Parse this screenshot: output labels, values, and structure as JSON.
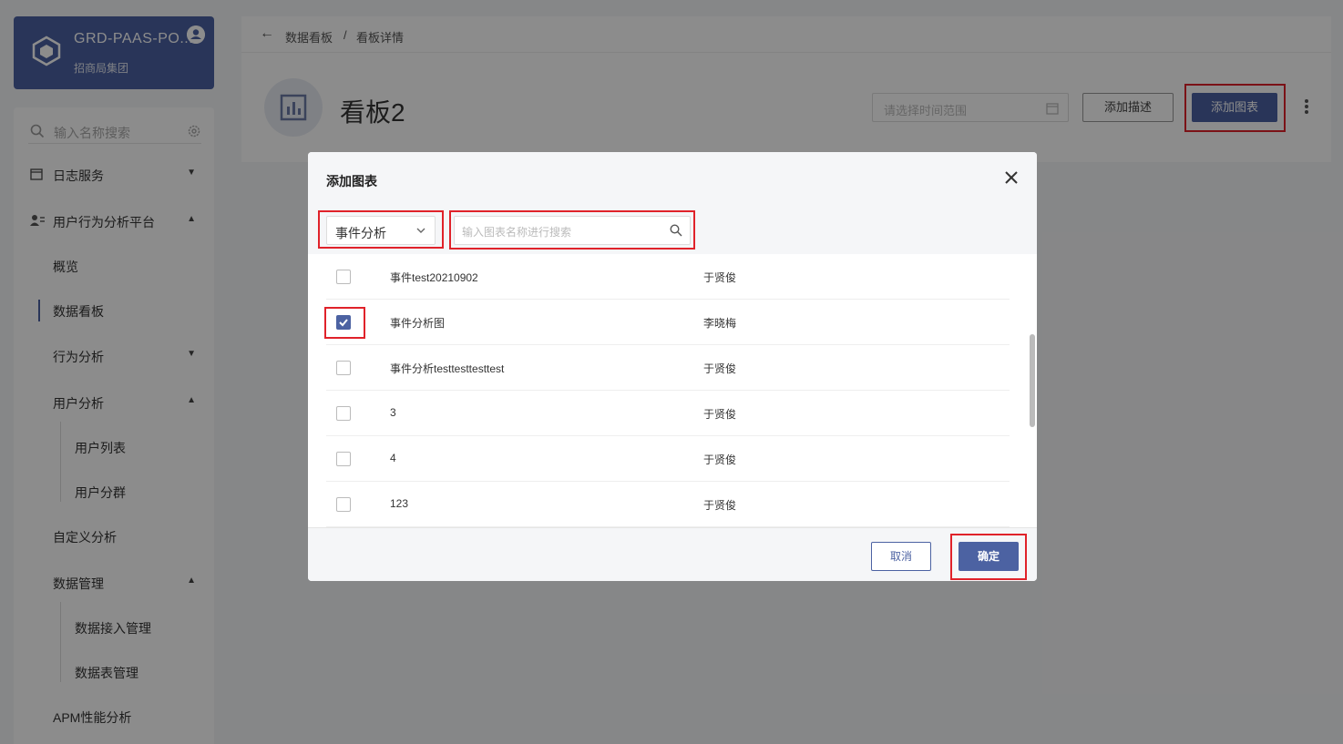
{
  "org": {
    "title": "GRD-PAAS-PO...",
    "subtitle": "招商局集团"
  },
  "sidebar": {
    "search_placeholder": "输入名称搜索",
    "items": [
      {
        "label": "日志服务"
      },
      {
        "label": "用户行为分析平台"
      },
      {
        "label": "概览"
      },
      {
        "label": "数据看板"
      },
      {
        "label": "行为分析"
      },
      {
        "label": "用户分析"
      },
      {
        "label": "用户列表"
      },
      {
        "label": "用户分群"
      },
      {
        "label": "自定义分析"
      },
      {
        "label": "数据管理"
      },
      {
        "label": "数据接入管理"
      },
      {
        "label": "数据表管理"
      },
      {
        "label": "APM性能分析"
      }
    ]
  },
  "breadcrumb": {
    "back": "←",
    "items": [
      "数据看板",
      "/",
      "看板详情"
    ]
  },
  "header": {
    "title": "看板2",
    "date_placeholder": "请选择时间范围",
    "add_desc_label": "添加描述",
    "add_chart_label": "添加图表"
  },
  "modal": {
    "title": "添加图表",
    "type_select": "事件分析",
    "search_placeholder": "输入图表名称进行搜索",
    "rows": [
      {
        "name": "事件test20210902",
        "owner": "于贤俊",
        "checked": false
      },
      {
        "name": "事件分析图",
        "owner": "李晓梅",
        "checked": true
      },
      {
        "name": "事件分析testtesttesttest",
        "owner": "于贤俊",
        "checked": false
      },
      {
        "name": "3",
        "owner": "于贤俊",
        "checked": false
      },
      {
        "name": "4",
        "owner": "于贤俊",
        "checked": false
      },
      {
        "name": "123",
        "owner": "于贤俊",
        "checked": false
      }
    ],
    "cancel_label": "取消",
    "ok_label": "确定"
  },
  "colors": {
    "primary": "#4c62a2",
    "highlight": "#e0222a"
  }
}
